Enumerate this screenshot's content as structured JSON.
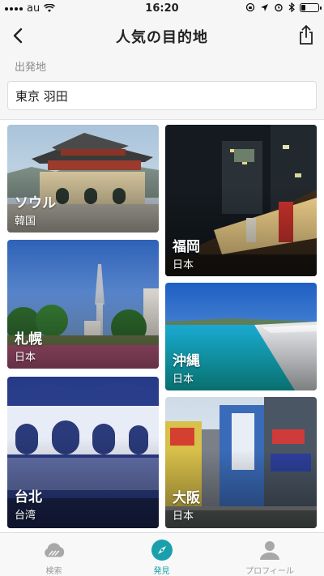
{
  "status_bar": {
    "carrier": "au",
    "time": "16:20"
  },
  "nav": {
    "title": "人気の目的地",
    "back_icon": "chevron-left-icon",
    "share_icon": "share-icon"
  },
  "origin": {
    "label": "出発地",
    "value": "東京 羽田"
  },
  "destinations": [
    {
      "city": "ソウル",
      "country": "韓国"
    },
    {
      "city": "福岡",
      "country": "日本"
    },
    {
      "city": "札幌",
      "country": "日本"
    },
    {
      "city": "沖縄",
      "country": "日本"
    },
    {
      "city": "台北",
      "country": "台湾"
    },
    {
      "city": "大阪",
      "country": "日本"
    }
  ],
  "tabs": [
    {
      "label": "検索",
      "icon": "cloud-search-icon",
      "active": false
    },
    {
      "label": "発見",
      "icon": "compass-icon",
      "active": true
    },
    {
      "label": "プロフィール",
      "icon": "person-icon",
      "active": false
    }
  ],
  "colors": {
    "accent": "#1aa0ad",
    "inactive": "#9a9a9a",
    "header_bg": "#f6f6f6"
  }
}
